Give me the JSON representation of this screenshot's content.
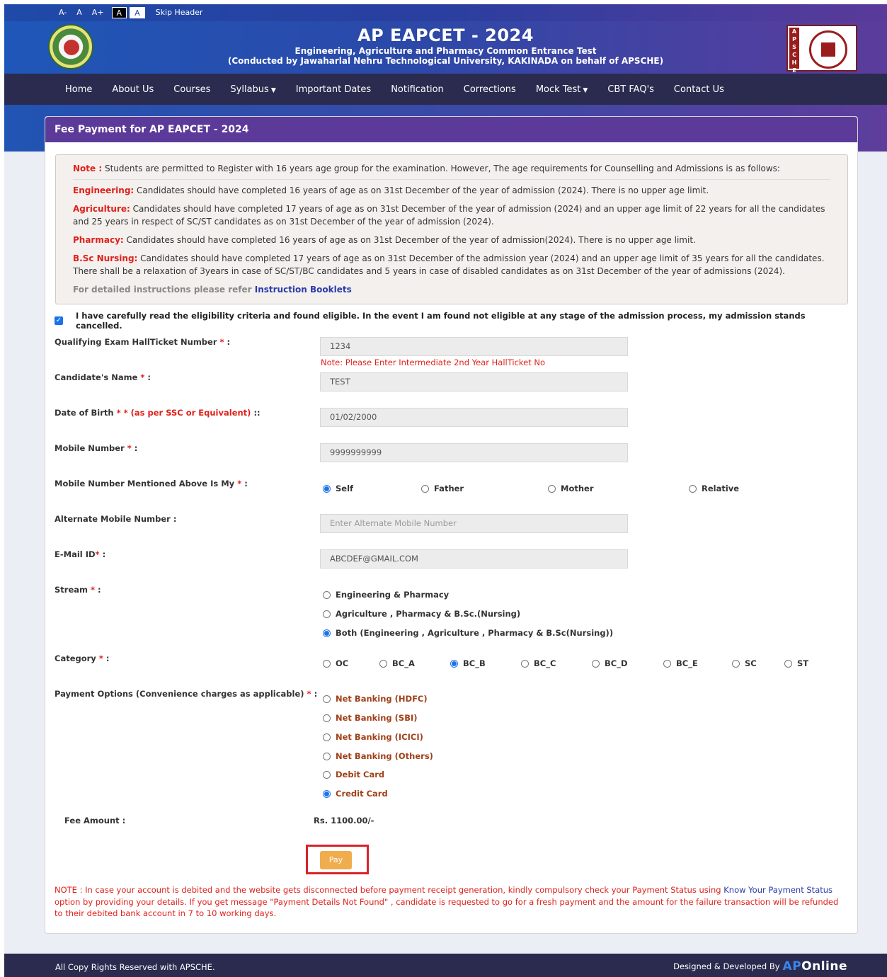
{
  "access_bar": {
    "decrease": "A-",
    "normal": "A",
    "increase": "A+",
    "dark_theme": "A",
    "light_theme": "A",
    "skip": "Skip Header"
  },
  "header": {
    "title": "AP EAPCET - 2024",
    "subtitle": "Engineering, Agriculture and Pharmacy Common Entrance Test",
    "subtitle2": "(Conducted by Jawaharlal Nehru Technological University, KAKINADA on behalf of APSCHE)",
    "right_logo_letters": "APSCHE"
  },
  "nav": {
    "home": "Home",
    "about": "About Us",
    "courses": "Courses",
    "syllabus": "Syllabus",
    "important_dates": "Important Dates",
    "notification": "Notification",
    "corrections": "Corrections",
    "mock_test": "Mock Test",
    "cbt_faq": "CBT FAQ's",
    "contact": "Contact Us"
  },
  "panel": {
    "title": "Fee Payment for AP EAPCET - 2024"
  },
  "note": {
    "note_label": "Note :",
    "note_text": " Students are permitted to Register with 16 years age group for the examination. However, The age requirements for Counselling and Admissions is as follows:",
    "eng_label": "Engineering:",
    "eng_text": " Candidates should have completed 16 years of age as on 31st December of the year of admission (2024). There is no upper age limit.",
    "agri_label": "Agriculture:",
    "agri_text": " Candidates should have completed 17 years of age as on 31st December of the year of admission (2024) and an upper age limit of 22 years for all the candidates and 25 years in respect of SC/ST candidates as on 31st December of the year of admission (2024).",
    "pharm_label": "Pharmacy:",
    "pharm_text": " Candidates should have completed 16 years of age as on 31st December of the year of admission(2024). There is no upper age limit.",
    "bsc_label": "B.Sc Nursing:",
    "bsc_text": " Candidates should have completed 17 years of age as on 31st December of the admission year (2024) and an upper age limit of 35 years for all the candidates. There shall be a relaxation of 3years in case of SC/ST/BC candidates and 5 years in case of disabled candidates as on 31st December of the year of admissions (2024).",
    "instr_prefix": "For detailed instructions please refer ",
    "instr_link": "Instruction Booklets"
  },
  "agree": {
    "text": "I have carefully read the eligibility criteria and found eligible. In the event I am found not eligible at any stage of the admission process, my admission stands cancelled."
  },
  "form": {
    "hallticket_label": "Qualifying Exam HallTicket Number",
    "hallticket_value": "1234",
    "hallticket_hint": "Note: Please Enter Intermediate 2nd Year HallTicket No",
    "name_label": "Candidate's Name",
    "name_value": "TEST",
    "dob_label": "Date of Birth",
    "dob_extra": "* (as per SSC or Equivalent)",
    "dob_value": "01/02/2000",
    "mobile_label": "Mobile Number",
    "mobile_value": "9999999999",
    "mobile_owner_label": "Mobile Number Mentioned Above Is My",
    "owner_options": [
      "Self",
      "Father",
      "Mother",
      "Relative"
    ],
    "alt_mobile_label": "Alternate Mobile Number :",
    "alt_mobile_placeholder": "Enter Alternate Mobile Number",
    "email_label": "E-Mail ID",
    "email_value": "ABCDEF@GMAIL.COM",
    "stream_label": "Stream",
    "stream_options": [
      "Engineering & Pharmacy",
      "Agriculture , Pharmacy & B.Sc.(Nursing)",
      "Both (Engineering , Agriculture , Pharmacy & B.Sc(Nursing))"
    ],
    "category_label": "Category",
    "category_options": [
      "OC",
      "BC_A",
      "BC_B",
      "BC_C",
      "BC_D",
      "BC_E",
      "SC",
      "ST"
    ],
    "payment_label": "Payment Options (Convenience charges as applicable)",
    "payment_options": [
      "Net Banking (HDFC)",
      "Net Banking (SBI)",
      "Net Banking (ICICI)",
      "Net Banking (Others)",
      "Debit Card",
      "Credit Card"
    ],
    "fee_label": "Fee Amount :",
    "fee_value": "Rs. 1100.00/-",
    "pay_button": "Pay"
  },
  "bottom_note": {
    "prefix": "NOTE : In case your account is debited and the website gets disconnected before payment receipt generation, kindly compulsory check your Payment Status using ",
    "link": "Know Your Payment Status",
    "suffix": " option by providing your details. If you get message \"Payment Details Not Found\" , candidate is requested to go for a fresh payment and the amount for the failure transaction will be refunded to their debited bank account in 7 to 10 working days."
  },
  "footer": {
    "copyright": "All Copy Rights Reserved with APSCHE.",
    "designed_by": "Designed & Developed By",
    "brand_ap": "AP",
    "brand_online": "Online"
  },
  "colors": {
    "header_blue": "#1f57b8",
    "header_purple": "#5b3c9c",
    "nav_dark": "#2a2b4e",
    "panel_head": "#5b3a9a",
    "required_red": "#e0211b",
    "pay_orange": "#f0ad4e",
    "radio_blue": "#1a73e8"
  }
}
